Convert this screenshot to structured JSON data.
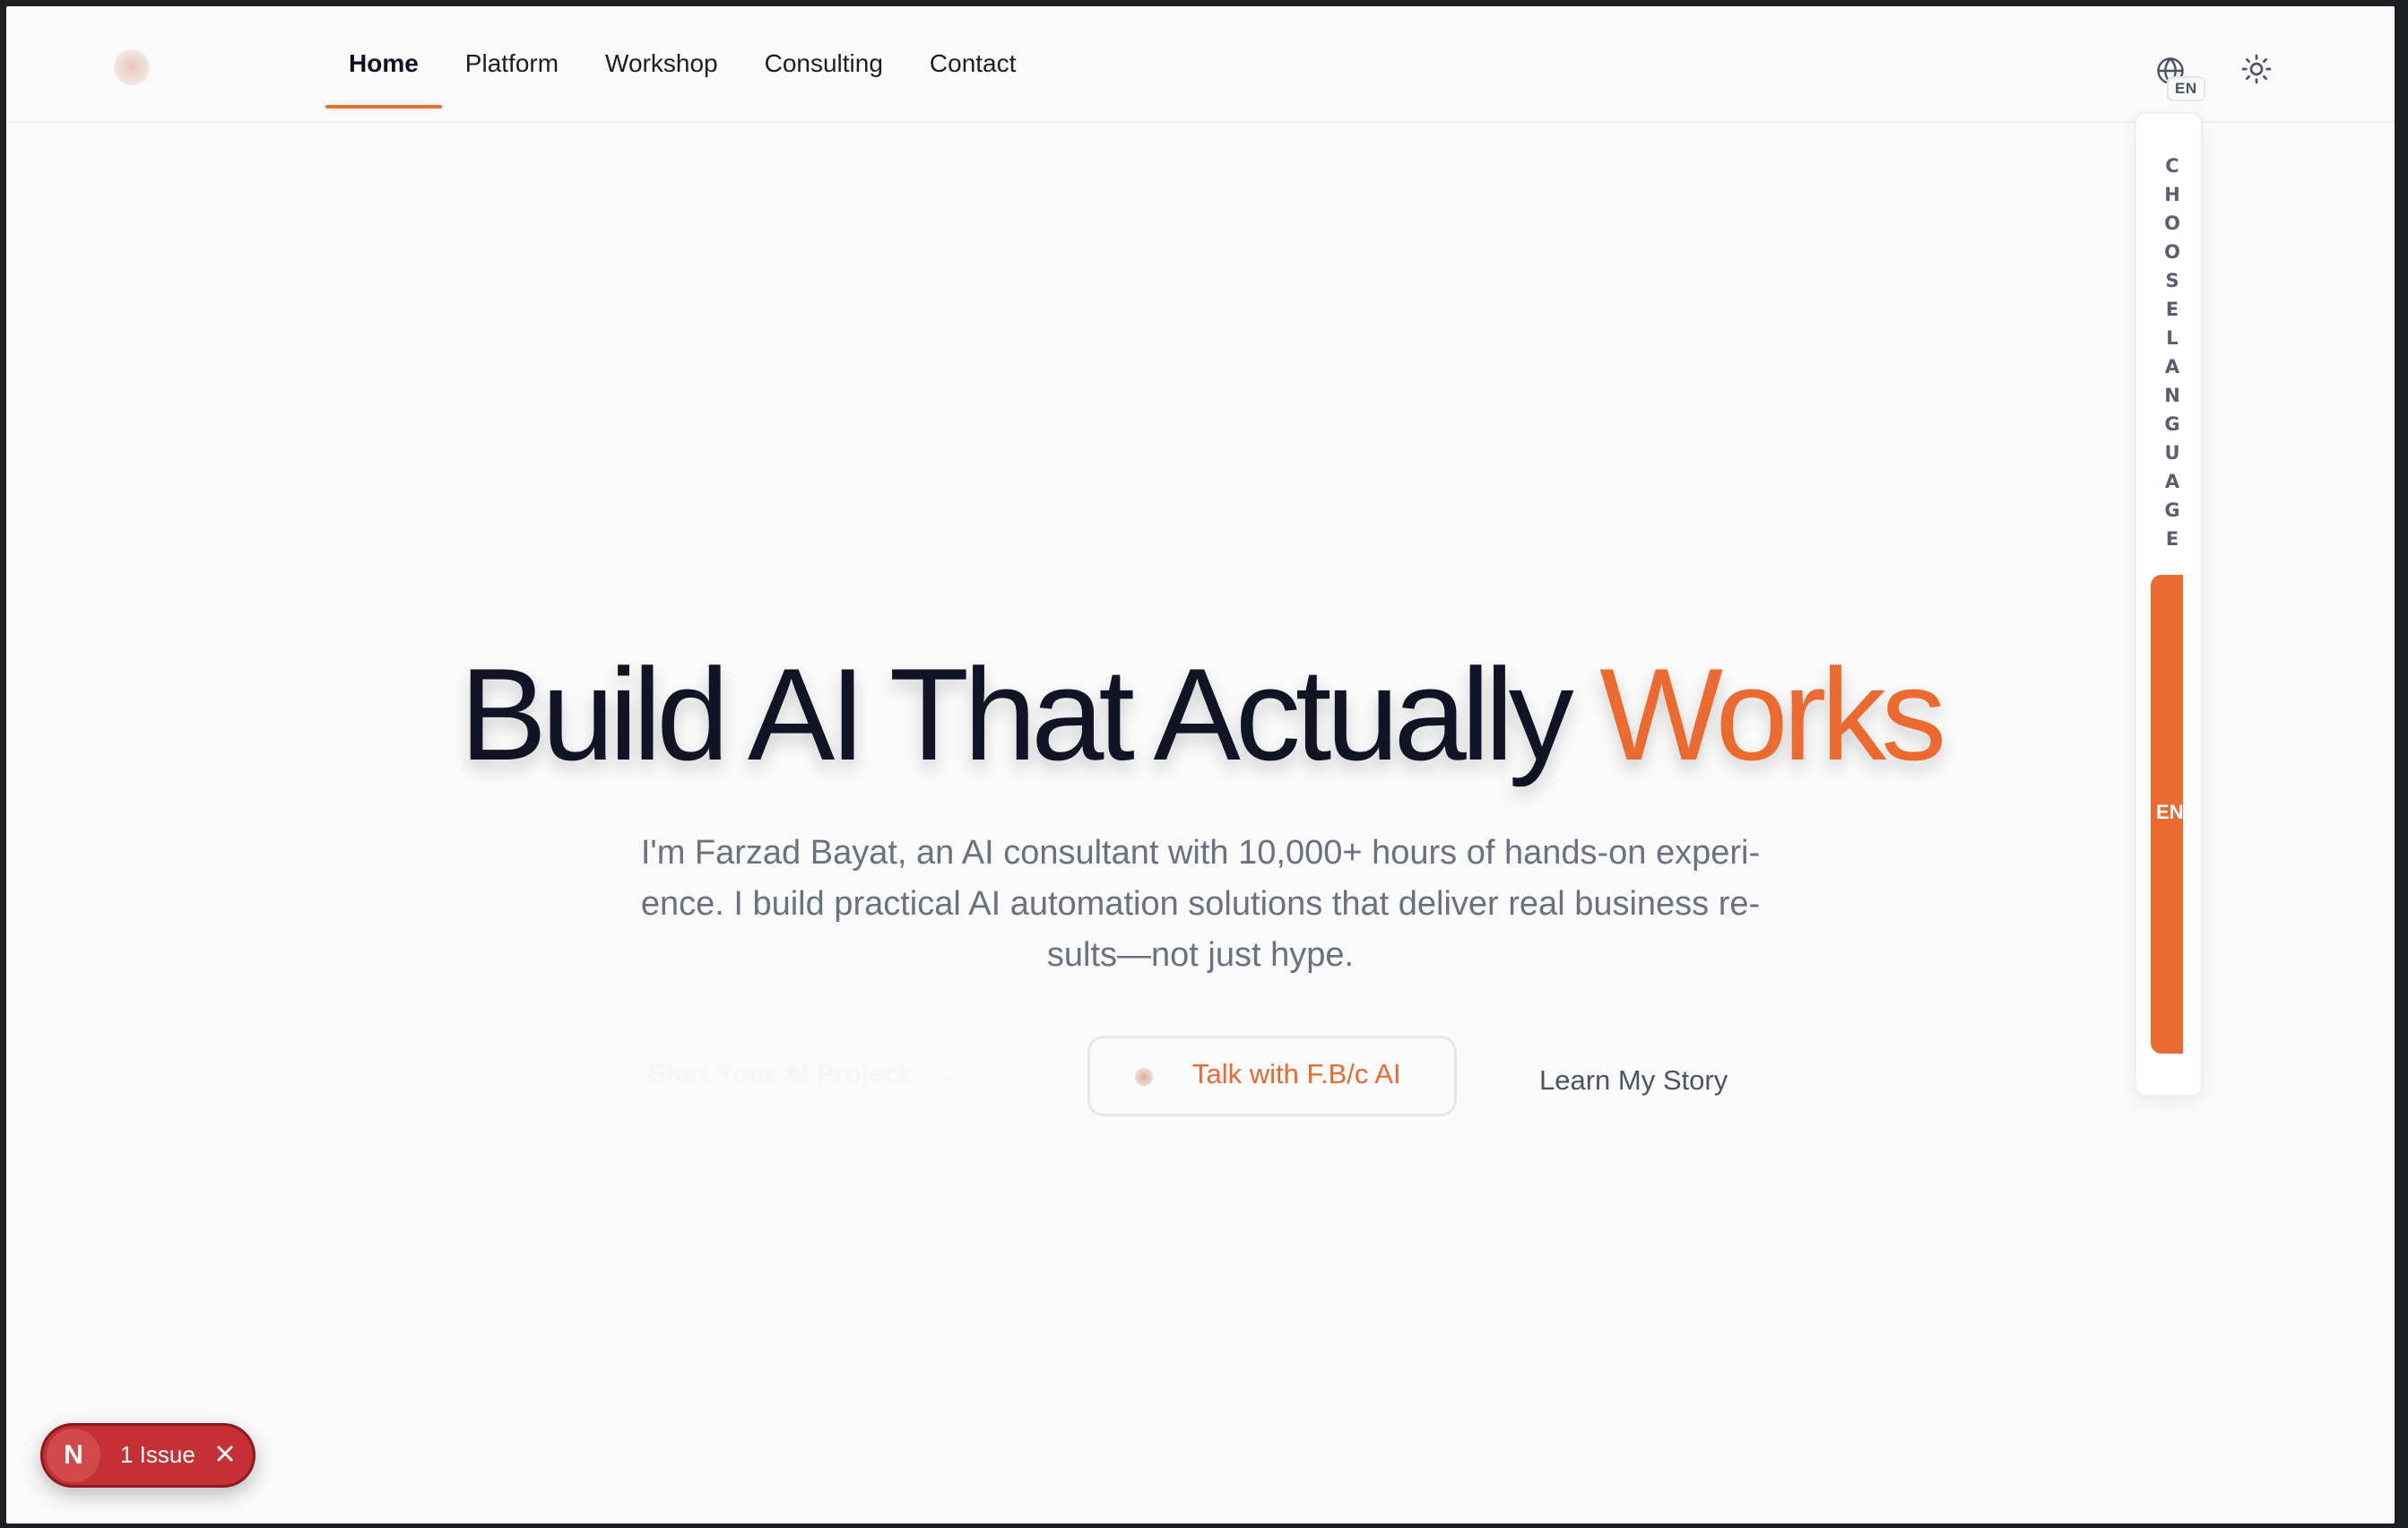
{
  "nav": {
    "items": [
      {
        "label": "Home",
        "active": true
      },
      {
        "label": "Platform"
      },
      {
        "label": "Workshop"
      },
      {
        "label": "Consulting"
      },
      {
        "label": "Contact"
      }
    ],
    "language_badge": "EN",
    "language_icon": "globe-icon",
    "theme_icon": "sun-icon"
  },
  "language_panel": {
    "title": "CHOOSE LANGUAGE",
    "options": [
      {
        "label": "EN",
        "selected": true
      }
    ]
  },
  "hero": {
    "title_main": "Build AI That Actually",
    "title_accent": "Works",
    "subtitle": "I'm Farzad Bayat, an AI consultant with 10,000+ hours of hands-on experi-ence. I build practical AI automation solutions that deliver real business re-sults—not just hype.",
    "cta_primary": "Start Your AI Project",
    "cta_primary_arrow": "→",
    "cta_chat": "Talk with F.B/c AI",
    "cta_story": "Learn My Story"
  },
  "dev_overlay": {
    "logo_letter": "N",
    "issue_label": "1 Issue",
    "close_icon": "close-icon"
  },
  "colors": {
    "accent": "#ea6a30",
    "text_dark": "#111425",
    "text_muted": "#6b7182",
    "background": "#fafafa",
    "issue_red": "#c62f33"
  }
}
